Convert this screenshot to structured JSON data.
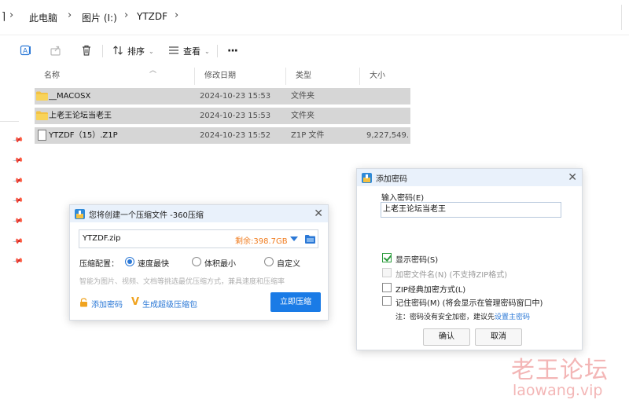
{
  "breadcrumb": {
    "items": [
      "此电脑",
      "图片 (I:)",
      "YTZDF"
    ]
  },
  "toolbar": {
    "sort_label": "排序",
    "view_label": "查看",
    "more_label": "···"
  },
  "file_list": {
    "columns": [
      "名称",
      "修改日期",
      "类型",
      "大小"
    ],
    "rows": [
      {
        "name": "__MACOSX",
        "modified": "2024-10-23 15:53",
        "type": "文件夹",
        "size": "",
        "icon": "folder-icon"
      },
      {
        "name": "上老王论坛当老王",
        "modified": "2024-10-23 15:53",
        "type": "文件夹",
        "size": "",
        "icon": "folder-icon"
      },
      {
        "name": "YTZDF（15）.Z1P",
        "modified": "2024-10-23 15:52",
        "type": "Z1P 文件",
        "size": "9,227,549...",
        "icon": "file-icon"
      }
    ]
  },
  "compress_dialog": {
    "title": "您将创建一个压缩文件 -360压缩",
    "filename": "YTZDF.zip",
    "free_space": "剩余:398.7GB",
    "config_label": "压缩配置：",
    "options": [
      "速度最快",
      "体积最小",
      "自定义"
    ],
    "selected_option": "速度最快",
    "hint": "智能为图片、视频、文档等挑选最优压缩方式，兼具速度和压缩率",
    "add_password": "添加密码",
    "super_package": "生成超级压缩包",
    "compress_now": "立即压缩"
  },
  "password_dialog": {
    "title": "添加密码",
    "input_label": "输入密码(E)",
    "password_value": "上老王论坛当老王",
    "show_password": "显示密码(S)",
    "show_password_checked": true,
    "encrypt_filenames": "加密文件名(N) (不支持ZIP格式)",
    "encrypt_filenames_enabled": false,
    "zip_classic": "ZIP经典加密方式(L)",
    "remember_password": "记住密码(M) (将会显示在管理密码窗口中)",
    "note": "注：密码没有安全加密，建议先",
    "note_link": "设置主密码",
    "ok_button": "确认",
    "cancel_button": "取消"
  },
  "watermark": {
    "line1": "老王论坛",
    "line2": "laowang.vip"
  },
  "colors": {
    "accent": "#1a7be6",
    "selection_row": "#d6d6d6",
    "free_space": "#f07c1f",
    "watermark": "#f3b6b6"
  }
}
